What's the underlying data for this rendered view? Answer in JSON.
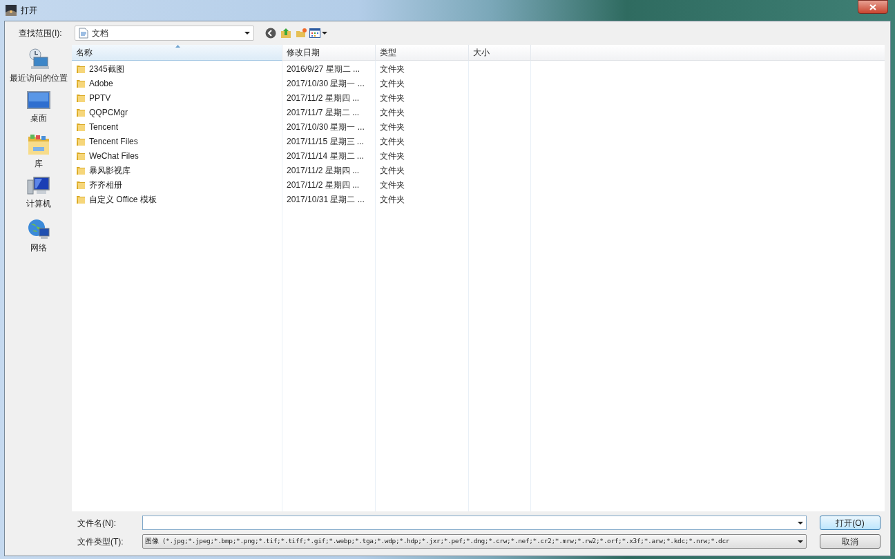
{
  "window": {
    "title": "打开"
  },
  "toolbar": {
    "look_in_label": "查找范围(I):",
    "look_in_value": "文档"
  },
  "places": [
    {
      "label": "最近访问的位置",
      "kind": "recent"
    },
    {
      "label": "桌面",
      "kind": "desktop"
    },
    {
      "label": "库",
      "kind": "library"
    },
    {
      "label": "计算机",
      "kind": "computer"
    },
    {
      "label": "网络",
      "kind": "network"
    }
  ],
  "table": {
    "columns": [
      {
        "label": "名称",
        "sorted": true
      },
      {
        "label": "修改日期",
        "sorted": false
      },
      {
        "label": "类型",
        "sorted": false
      },
      {
        "label": "大小",
        "sorted": false
      }
    ],
    "rows": [
      {
        "name": "2345截图",
        "modified": "2016/9/27 星期二 ...",
        "type": "文件夹"
      },
      {
        "name": "Adobe",
        "modified": "2017/10/30 星期一 ...",
        "type": "文件夹"
      },
      {
        "name": "PPTV",
        "modified": "2017/11/2 星期四 ...",
        "type": "文件夹"
      },
      {
        "name": "QQPCMgr",
        "modified": "2017/11/7 星期二 ...",
        "type": "文件夹"
      },
      {
        "name": "Tencent",
        "modified": "2017/10/30 星期一 ...",
        "type": "文件夹"
      },
      {
        "name": "Tencent Files",
        "modified": "2017/11/15 星期三 ...",
        "type": "文件夹"
      },
      {
        "name": "WeChat Files",
        "modified": "2017/11/14 星期二 ...",
        "type": "文件夹"
      },
      {
        "name": "暴风影视库",
        "modified": "2017/11/2 星期四 ...",
        "type": "文件夹"
      },
      {
        "name": "齐齐相册",
        "modified": "2017/11/2 星期四 ...",
        "type": "文件夹"
      },
      {
        "name": "自定义 Office 模板",
        "modified": "2017/10/31 星期二 ...",
        "type": "文件夹"
      }
    ]
  },
  "footer": {
    "file_name_label": "文件名(N):",
    "file_type_label": "文件类型(T):",
    "file_type_value": "图像 (*.jpg;*.jpeg;*.bmp;*.png;*.tif;*.tiff;*.gif;*.webp;*.tga;*.wdp;*.hdp;*.jxr;*.pef;*.dng;*.crw;*.nef;*.cr2;*.mrw;*.rw2;*.orf;*.x3f;*.arw;*.kdc;*.nrw;*.dcr",
    "open_button": "打开(O)",
    "cancel_button": "取消"
  }
}
